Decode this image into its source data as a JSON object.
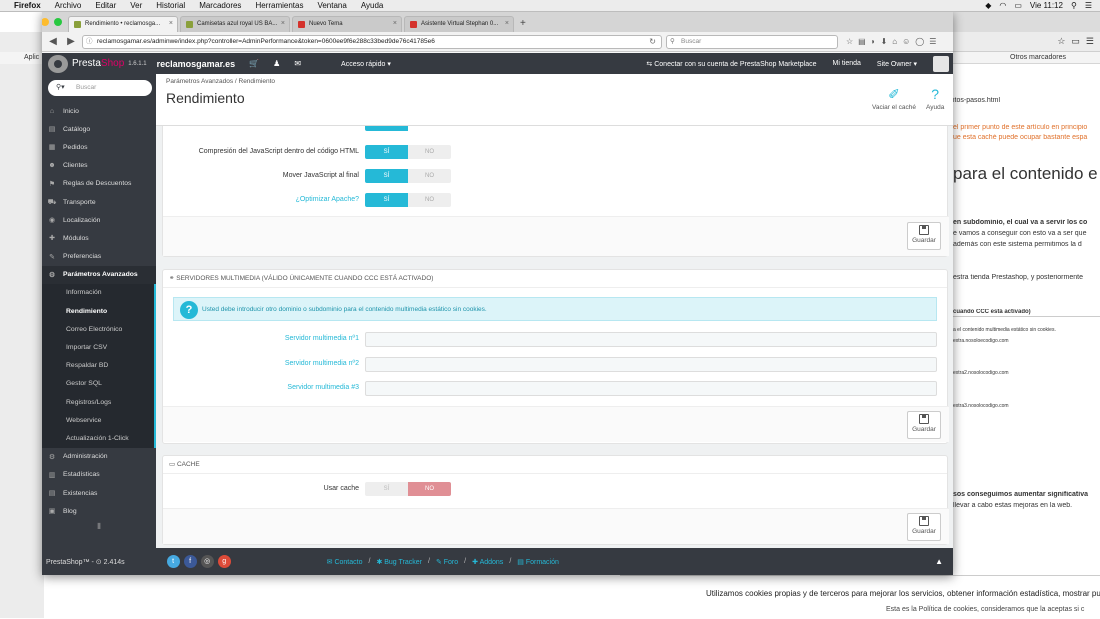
{
  "menubar": {
    "app": "Firefox",
    "items": [
      "Archivo",
      "Editar",
      "Ver",
      "Historial",
      "Marcadores",
      "Herramientas",
      "Ventana",
      "Ayuda"
    ],
    "clock": "Vie 11:12"
  },
  "browser": {
    "tabs": [
      {
        "label": "Rendimiento • reclamosga...",
        "color": "#8aa03b"
      },
      {
        "label": "Camisetas azul royal US BA...",
        "color": "#8aa03b"
      },
      {
        "label": "Nuevo Tema",
        "color": "#d4322c"
      },
      {
        "label": "Asistente Virtual Stephan 0...",
        "color": "#d4322c"
      }
    ],
    "url": "reclamosgamar.es/adminwe/index.php?controller=AdminPerformance&token=0600ee9f6e288c33bed9de76c41785e6",
    "search_placeholder": "Buscar",
    "bookmark_left": "Aplic",
    "bookmark_right": "Otros marcadores"
  },
  "background_page": {
    "url_fragment": "itos-pasos.html",
    "lines": [
      {
        "t": "el primer punto de este artículo en principio",
        "c": "#e0712b"
      },
      {
        "t": "ue esta caché puede ocupar bastante espa",
        "c": "#e0712b"
      },
      {
        "t": "para el contenido e",
        "c": "#333"
      },
      {
        "t": "en subdominio, el cual va a servir los co",
        "c": "#333"
      },
      {
        "t": "e vamos a conseguir con esto va a ser que",
        "c": "#333"
      },
      {
        "t": "además con este sistema permitimos la d",
        "c": "#333"
      },
      {
        "t": "estra tienda Prestashop, y posteriormente",
        "c": "#333"
      },
      {
        "t": "cuando CCC está activado)",
        "c": "#333"
      },
      {
        "t": "a el contenido multimedia estático sin cookies.",
        "c": "#555"
      },
      {
        "t": "extra.nosoloecodigo.com",
        "c": "#555"
      },
      {
        "t": "extra2.nosolocodigo.com",
        "c": "#555"
      },
      {
        "t": "extra3.nosolocodigo.com",
        "c": "#555"
      },
      {
        "t": "sos conseguimos aumentar significativa",
        "c": "#333"
      },
      {
        "t": "llevar a cabo estas mejoras en la web.",
        "c": "#333"
      }
    ],
    "cookie_line1": "Utilizamos cookies propias y de terceros para mejorar los servicios, obtener información estadística, mostrar pub",
    "cookie_line2": "Esta es la Política de cookies, consideramos que la aceptas si c"
  },
  "header": {
    "brand_a": "Presta",
    "brand_b": "Shop",
    "version": "1.6.1.1",
    "shop": "reclamosgamar.es",
    "quick_access": "Acceso rápido ▾",
    "connect": "Conectar con su cuenta de PrestaShop Marketplace",
    "my_shop": "Mi tienda",
    "owner": "Site Owner ▾"
  },
  "sidebar": {
    "search_placeholder": "Buscar",
    "items": [
      {
        "label": "Inicio",
        "icon": "⌂"
      },
      {
        "label": "Catálogo",
        "icon": "▤"
      },
      {
        "label": "Pedidos",
        "icon": "▦"
      },
      {
        "label": "Clientes",
        "icon": "☻"
      },
      {
        "label": "Reglas de Descuentos",
        "icon": "⚑"
      },
      {
        "label": "Transporte",
        "icon": "⛟"
      },
      {
        "label": "Localización",
        "icon": "◉"
      },
      {
        "label": "Módulos",
        "icon": "✚"
      },
      {
        "label": "Preferencias",
        "icon": "✎"
      },
      {
        "label": "Parámetros Avanzados",
        "icon": "⚙"
      }
    ],
    "subitems": [
      "Información",
      "Rendimiento",
      "Correo Electrónico",
      "Importar CSV",
      "Respaldar BD",
      "Gestor SQL",
      "Registros/Logs",
      "Webservice",
      "Actualización 1-Click"
    ],
    "items_after": [
      {
        "label": "Administración",
        "icon": "⚙"
      },
      {
        "label": "Estadísticas",
        "icon": "▥"
      },
      {
        "label": "Existencias",
        "icon": "▤"
      },
      {
        "label": "Blog",
        "icon": "▣"
      }
    ]
  },
  "page": {
    "breadcrumb": "Parámetros Avanzados  /  Rendimiento",
    "title": "Rendimiento",
    "clear_cache": "Vaciar el caché",
    "help": "Ayuda"
  },
  "ccc_panel": {
    "rows": [
      {
        "label": "Compresión del JavaScript dentro del código HTML",
        "yes": "SÍ",
        "no": "NO",
        "link": false
      },
      {
        "label": "Mover JavaScript al final",
        "yes": "SÍ",
        "no": "NO",
        "link": false
      },
      {
        "label": "¿Optimizar Apache?",
        "yes": "SÍ",
        "no": "NO",
        "link": true
      }
    ],
    "save": "Guardar"
  },
  "media_panel": {
    "heading": "SERVIDORES MULTIMEDIA (VÁLIDO ÚNICAMENTE CUANDO CCC ESTÁ ACTIVADO)",
    "alert": "Usted debe introducir otro dominio o subdominio para el contenido multimedia estático sin cookies.",
    "servers": [
      "Servidor multimedia nº1",
      "Servidor multimedia nº2",
      "Servidor multimedia #3"
    ],
    "save": "Guardar"
  },
  "cache_panel": {
    "heading": "CACHE",
    "label": "Usar cache",
    "yes": "SÍ",
    "no": "NO",
    "save": "Guardar"
  },
  "footer": {
    "version": "PrestaShop™ - ⊙ 2.414s",
    "links": [
      "Contacto",
      "Bug Tracker",
      "Foro",
      "Addons",
      "Formación"
    ]
  }
}
